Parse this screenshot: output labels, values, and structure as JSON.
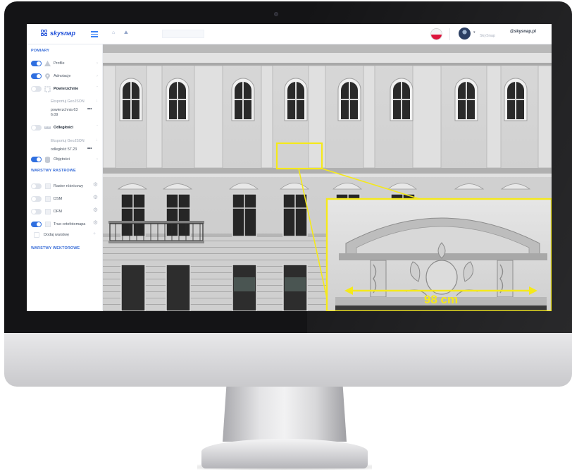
{
  "topbar": {
    "logo_text": "skysnap",
    "nav_home": "⌂",
    "nav_map": "⛰",
    "search_placeholder": "",
    "user_caret": "▾",
    "user_name": "SkySnap",
    "email": "@skysnap.pl"
  },
  "sidebar": {
    "section_measurements": "POMIARY",
    "items": [
      {
        "label": "Profile",
        "toggle": "on",
        "icon": "triangle-profile-icon"
      },
      {
        "label": "Adnotacje",
        "toggle": "on",
        "icon": "map-pin-icon"
      },
      {
        "label": "Powierzchnie",
        "toggle": "off",
        "icon": "area-frame-icon"
      },
      {
        "label": "Odległości",
        "toggle": "off",
        "icon": "ruler-icon"
      },
      {
        "label": "Objętości",
        "toggle": "on",
        "icon": "cylinder-icon"
      }
    ],
    "area_export": "Eksportuj GeoJSON",
    "area_value_line1": "powierzchnia 63",
    "area_value_line2": "6.09",
    "distance_export": "Eksportuj GeoJSON",
    "distance_value": "odległość 57.23",
    "more": "•••",
    "section_raster": "WARSTWY RASTROWE",
    "raster_layers": [
      {
        "label": "Raster różnicowy",
        "toggle": "off"
      },
      {
        "label": "DSM",
        "toggle": "off"
      },
      {
        "label": "DFM",
        "toggle": "off"
      },
      {
        "label": "True-ortofotomapa",
        "toggle": "on"
      }
    ],
    "add_layer": "Dodaj warstwę",
    "add_plus": "+",
    "section_vector": "WARSTWY WEKTOROWE"
  },
  "callout": {
    "measurement": "98 cm",
    "highlight_color": "#f5e91a"
  },
  "colors": {
    "accent": "#2f6fe0",
    "section": "#3b6fd8",
    "bezel": "#141416"
  }
}
